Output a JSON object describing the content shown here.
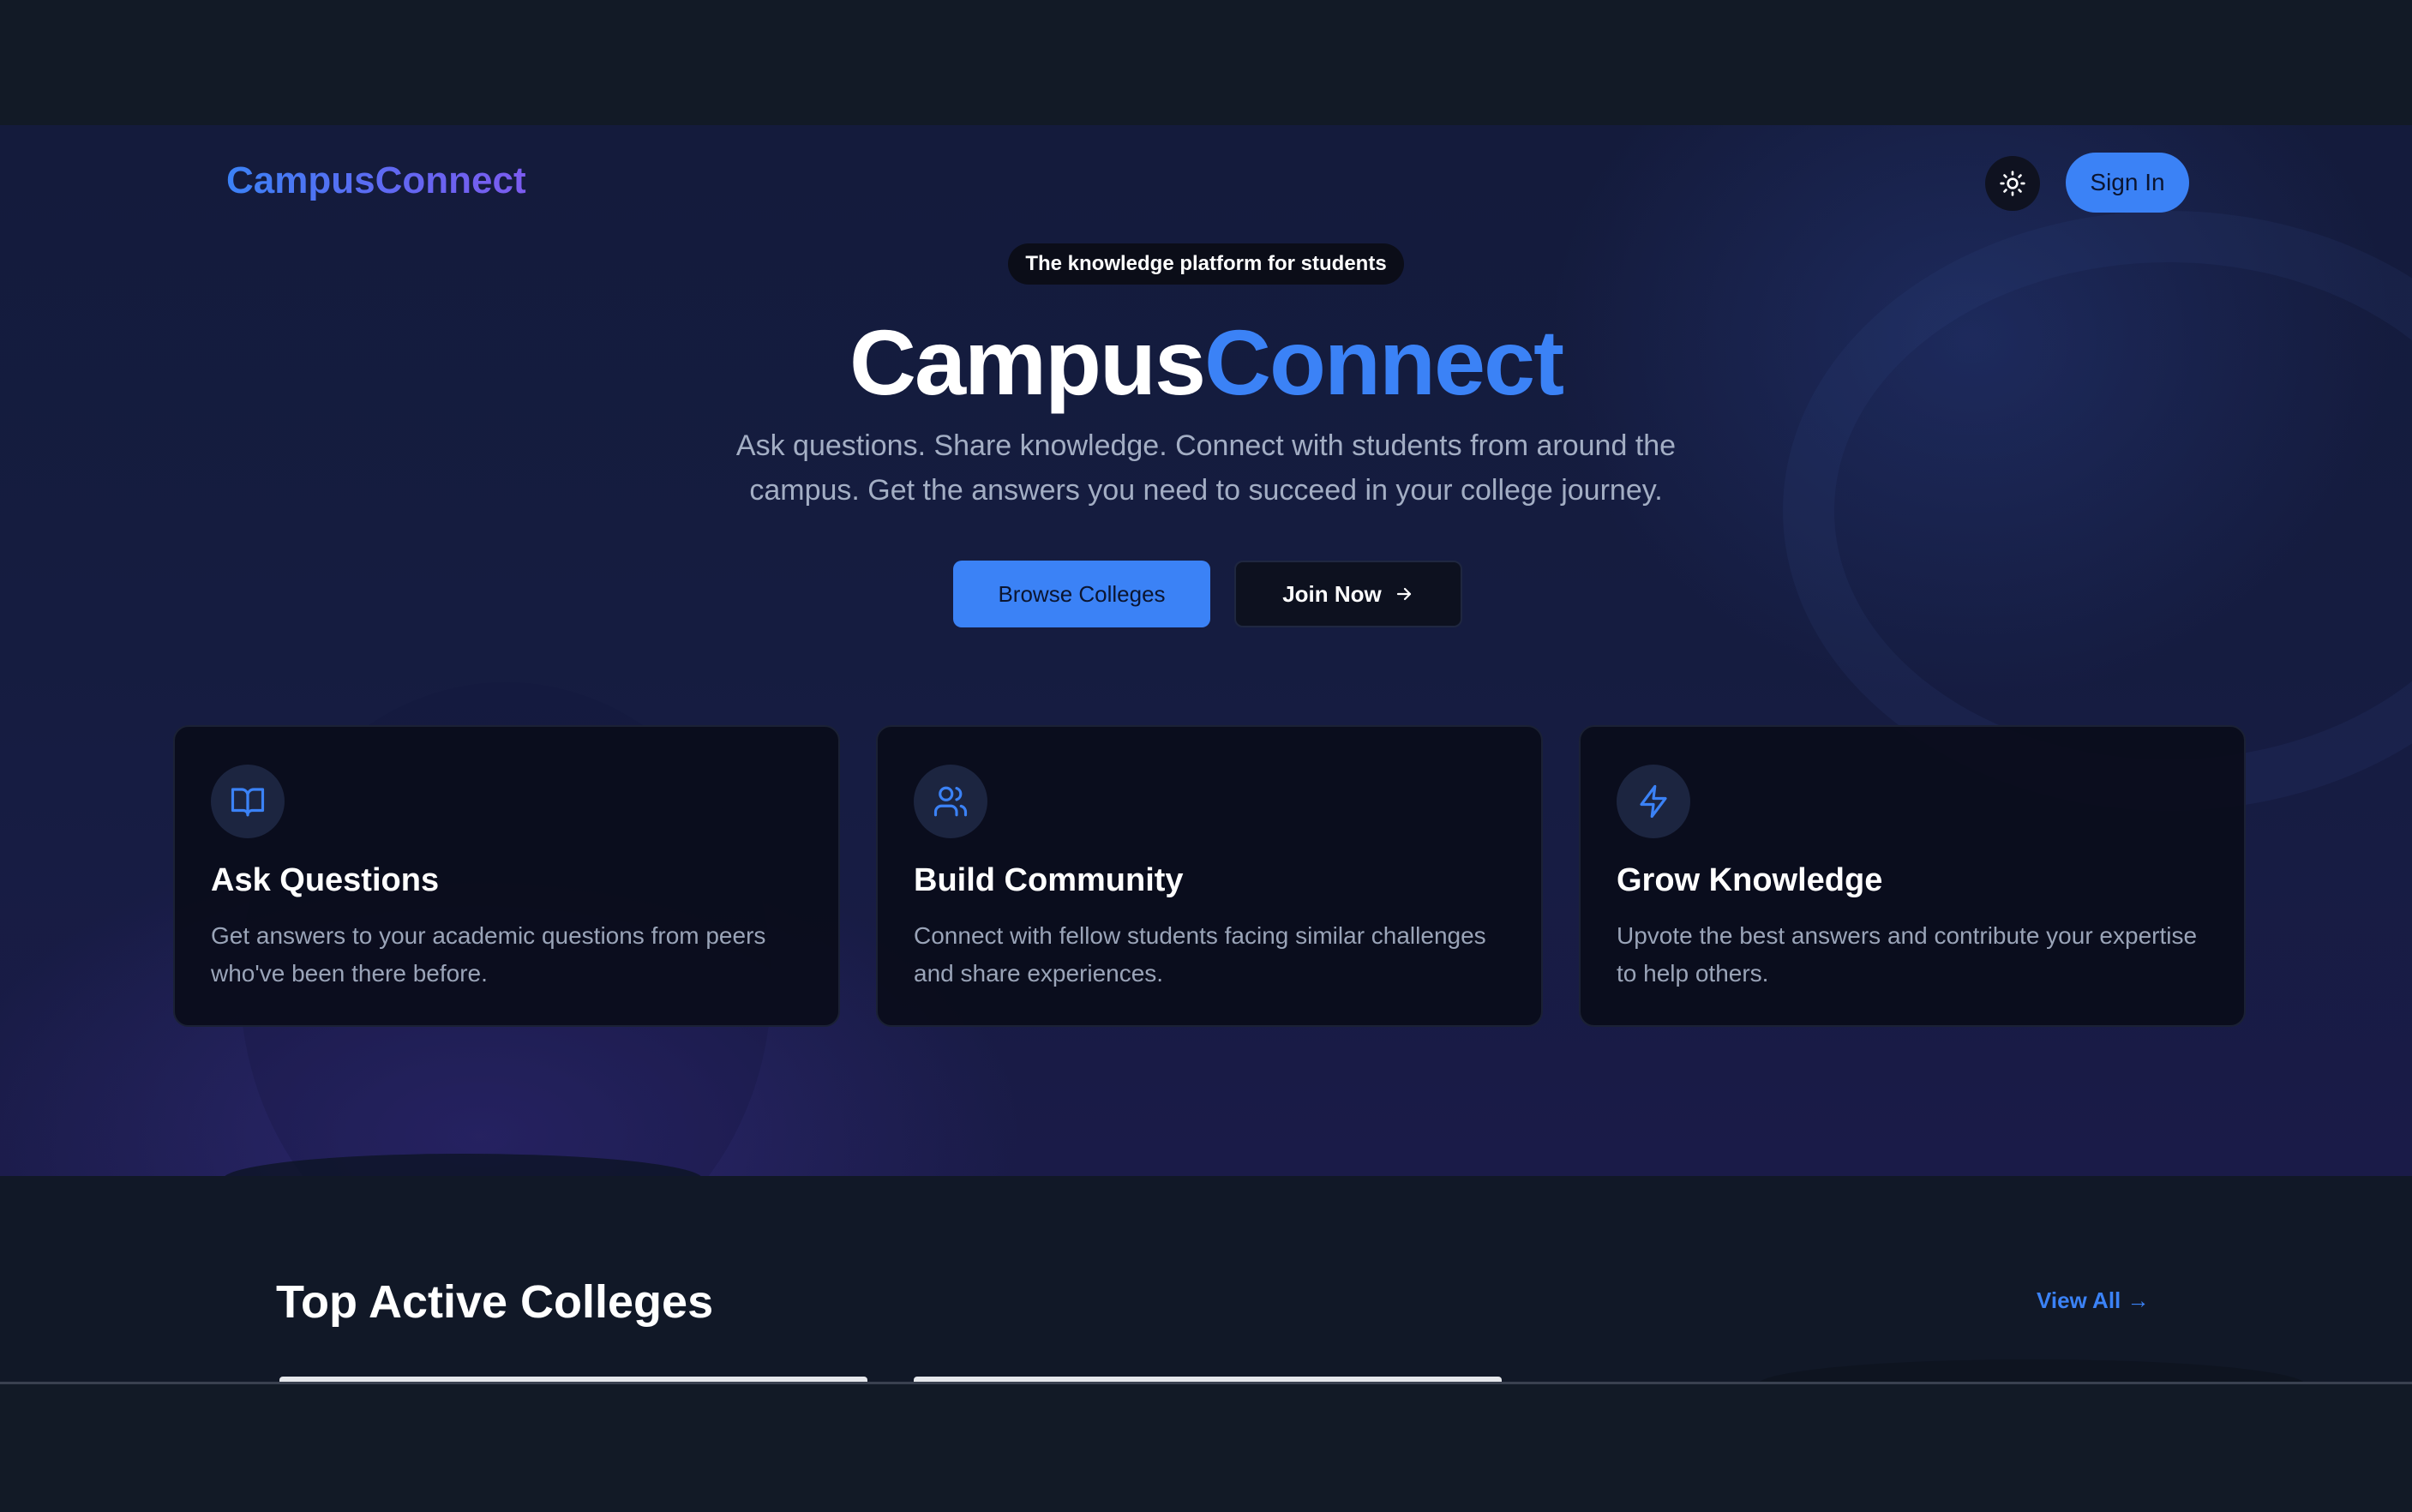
{
  "header": {
    "logo": "CampusConnect",
    "theme_toggle_icon": "sun-icon",
    "signin_label": "Sign In"
  },
  "hero": {
    "badge": "The knowledge platform for students",
    "title_part1": "Campus",
    "title_part2": "Connect",
    "subtitle": "Ask questions. Share knowledge. Connect with students from around the campus. Get the answers you need to succeed in your college journey.",
    "browse_label": "Browse Colleges",
    "join_label": "Join Now",
    "join_icon": "arrow-right-icon"
  },
  "features": [
    {
      "icon": "book-open-icon",
      "title": "Ask Questions",
      "text": "Get answers to your academic questions from peers who've been there before."
    },
    {
      "icon": "users-icon",
      "title": "Build Community",
      "text": "Connect with fellow students facing similar challenges and share experiences."
    },
    {
      "icon": "lightning-icon",
      "title": "Grow Knowledge",
      "text": "Upvote the best answers and contribute your expertise to help others."
    }
  ],
  "colleges_section": {
    "title": "Top Active Colleges",
    "view_all": "View All →"
  },
  "colors": {
    "accent": "#3b82f6",
    "background": "#111827",
    "hero_bg": "#151c40",
    "card_bg": "#0a0c1a"
  }
}
